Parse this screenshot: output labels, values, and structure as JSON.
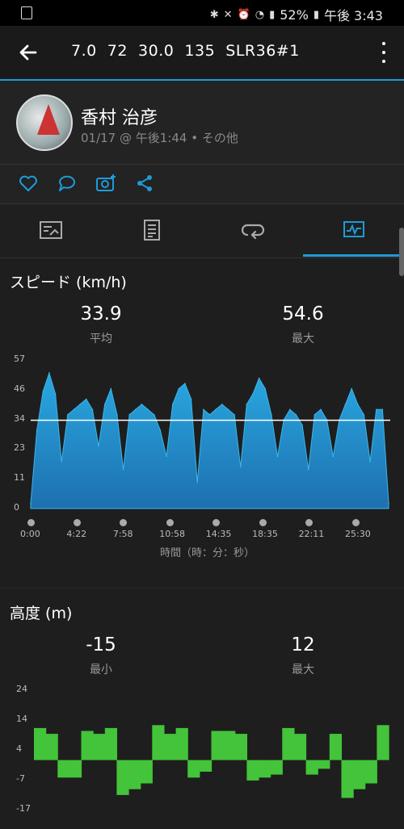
{
  "status_bar": {
    "battery": "52%",
    "time": "午後 3:43"
  },
  "app_bar": {
    "title": "7.0  72  30.0  135  SLR36#1"
  },
  "profile": {
    "name": "香村 治彦",
    "meta": "01/17 @ 午後1:44 • その他"
  },
  "tabs": [
    {
      "name": "tab-overview",
      "icon": "summary-icon"
    },
    {
      "name": "tab-details",
      "icon": "document-icon"
    },
    {
      "name": "tab-laps",
      "icon": "laps-icon"
    },
    {
      "name": "tab-charts",
      "icon": "chart-icon",
      "active": true
    }
  ],
  "speed": {
    "title": "スピード (km/h)",
    "avg_value": "33.9",
    "avg_label": "平均",
    "max_value": "54.6",
    "max_label": "最大",
    "xaxis_label": "時間（時：分：秒）"
  },
  "altitude": {
    "title": "高度 (m)",
    "min_value": "-15",
    "min_label": "最小",
    "max_value": "12",
    "max_label": "最大"
  },
  "chart_data": [
    {
      "type": "area",
      "title": "スピード (km/h)",
      "xlabel": "時間（時：分：秒）",
      "ylabel": "",
      "ylim": [
        0,
        57
      ],
      "y_ticks": [
        "57",
        "46",
        "34",
        "23",
        "11",
        "0"
      ],
      "x_ticks": [
        "0:00",
        "4:22",
        "7:58",
        "10:58",
        "14:35",
        "18:35",
        "22:11",
        "25:30"
      ],
      "reference_line": 33.9,
      "color": "#2196d3",
      "x_min": [
        0,
        0.5,
        1,
        1.5,
        2,
        2.5,
        3,
        3.5,
        4,
        4.5,
        5,
        5.5,
        6,
        6.5,
        7,
        7.5,
        8,
        8.5,
        9,
        9.5,
        10,
        10.5,
        11,
        11.5,
        12,
        12.5,
        13,
        13.5,
        14,
        14.5,
        15,
        15.5,
        16,
        16.5,
        17,
        17.5,
        18,
        18.5,
        19,
        19.5,
        20,
        20.5,
        21,
        21.5,
        22,
        22.5,
        23,
        23.5,
        24,
        24.5,
        25,
        25.5,
        26,
        26.5,
        27,
        27.5,
        28,
        28.5,
        29
      ],
      "values": [
        2,
        30,
        45,
        52,
        44,
        18,
        36,
        38,
        40,
        42,
        38,
        24,
        40,
        46,
        36,
        15,
        36,
        38,
        40,
        38,
        36,
        30,
        20,
        40,
        46,
        48,
        42,
        10,
        38,
        36,
        38,
        40,
        38,
        36,
        16,
        40,
        44,
        50,
        46,
        36,
        20,
        34,
        38,
        36,
        32,
        15,
        36,
        38,
        34,
        20,
        34,
        40,
        46,
        40,
        36,
        18,
        38,
        38,
        2
      ]
    },
    {
      "type": "area",
      "title": "高度 (m)",
      "ylim": [
        -17,
        24
      ],
      "y_ticks": [
        "24",
        "14",
        "4",
        "-7",
        "-17"
      ],
      "color": "#46c83c",
      "x_min": [
        0,
        1,
        2,
        3,
        4,
        5,
        6,
        7,
        8,
        9,
        10,
        11,
        12,
        13,
        14,
        15,
        16,
        17,
        18,
        19,
        20,
        21,
        22,
        23,
        24,
        25,
        26,
        27,
        28,
        29
      ],
      "values": [
        11,
        9,
        -6,
        -6,
        10,
        9,
        11,
        -12,
        -10,
        -8,
        12,
        9,
        11,
        -6,
        -4,
        10,
        10,
        9,
        -7,
        -6,
        -5,
        11,
        9,
        -5,
        -3,
        9,
        -13,
        -10,
        -8,
        12
      ]
    }
  ]
}
